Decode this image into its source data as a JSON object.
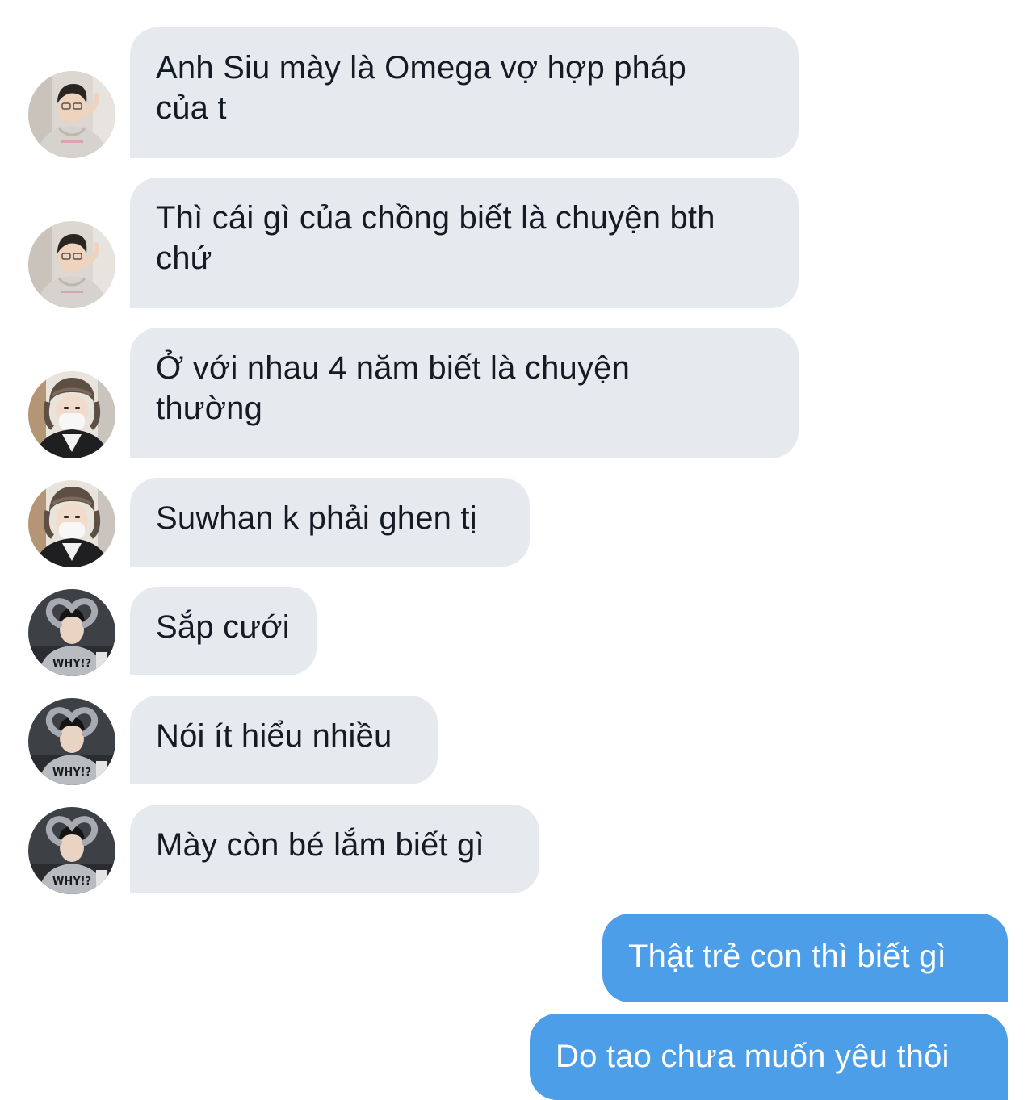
{
  "conversation": {
    "incoming_messages": [
      {
        "sender_avatar": "avatar-hoodie-glasses",
        "text": "Anh Siu mày là Omega vợ hợp pháp\ncủa t"
      },
      {
        "sender_avatar": "avatar-hoodie-glasses",
        "text": "Thì cái gì của chồng biết là chuyện bth\nchứ"
      },
      {
        "sender_avatar": "avatar-fur-hat-mask",
        "text": "Ở với nhau 4 năm biết là chuyện\nthường"
      },
      {
        "sender_avatar": "avatar-fur-hat-mask",
        "text": "Suwhan k phải ghen tị"
      },
      {
        "sender_avatar": "avatar-heart-pose",
        "text": "Sắp cưới"
      },
      {
        "sender_avatar": "avatar-heart-pose",
        "text": "Nói ít hiểu nhiều"
      },
      {
        "sender_avatar": "avatar-heart-pose",
        "text": "Mày còn bé lắm biết gì"
      }
    ],
    "outgoing_messages": [
      {
        "text": "Thật trẻ con thì biết gì"
      },
      {
        "text": "Do tao chưa muốn yêu thôi"
      }
    ]
  },
  "colors": {
    "incoming_bubble": "#e6eaef",
    "outgoing_bubble": "#4c9ee8",
    "incoming_text": "#151b24",
    "outgoing_text": "#ffffff",
    "background": "#ffffff"
  }
}
